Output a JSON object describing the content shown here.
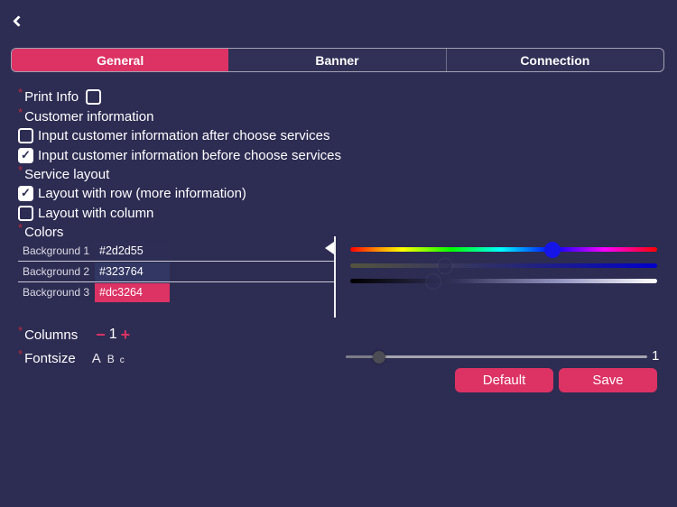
{
  "theme": {
    "background": "#2d2c53",
    "accent": "#dc3264",
    "text": "#ffffff"
  },
  "marks": {
    "required": "*",
    "check": "✓",
    "minus": "−",
    "plus": "+"
  },
  "header": {
    "back_icon": "chevron-left"
  },
  "tabs": [
    {
      "label": "General",
      "active": true
    },
    {
      "label": "Banner",
      "active": false
    },
    {
      "label": "Connection",
      "active": false
    }
  ],
  "settings": {
    "print_info": {
      "label": "Print Info",
      "checked": false
    },
    "customer_information": {
      "label": "Customer information",
      "options": [
        {
          "label": "Input customer information after choose services",
          "checked": false
        },
        {
          "label": "Input customer information before choose services",
          "checked": true
        }
      ]
    },
    "service_layout": {
      "label": "Service layout",
      "options": [
        {
          "label": "Layout with row (more information)",
          "checked": true
        },
        {
          "label": "Layout with column",
          "checked": false
        }
      ]
    },
    "colors": {
      "label": "Colors",
      "rows": [
        {
          "label": "Background 1",
          "value": "#2d2d55"
        },
        {
          "label": "Background 2",
          "value": "#323764"
        },
        {
          "label": "Background 3",
          "value": "#dc3264"
        }
      ]
    },
    "columns": {
      "label": "Columns",
      "value": "1"
    },
    "fontsize": {
      "label": "Fontsize",
      "letters": [
        "A",
        "B",
        "c"
      ],
      "slider_value": "1",
      "slider_position_pct": 11
    }
  },
  "color_picker": {
    "hue_position_pct": 66,
    "saturation_position_pct": 31,
    "brightness_position_pct": 27
  },
  "buttons": {
    "default": "Default",
    "save": "Save"
  }
}
